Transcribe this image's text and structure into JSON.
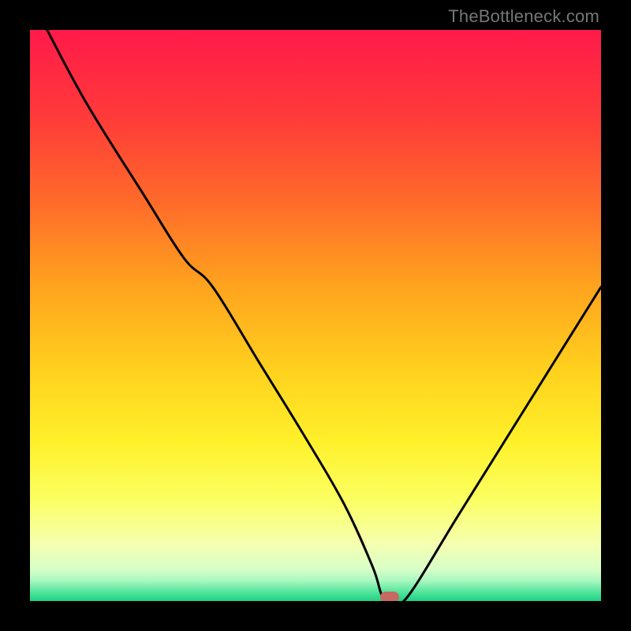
{
  "watermark": "TheBottleneck.com",
  "colors": {
    "frame": "#000000",
    "curve": "#000000",
    "marker": "#c66a64",
    "gradient_stops": [
      {
        "offset": 0.0,
        "color": "#ff1a4a"
      },
      {
        "offset": 0.15,
        "color": "#ff3a3a"
      },
      {
        "offset": 0.3,
        "color": "#ff6a2a"
      },
      {
        "offset": 0.45,
        "color": "#ffa41e"
      },
      {
        "offset": 0.6,
        "color": "#ffd21e"
      },
      {
        "offset": 0.72,
        "color": "#fff02a"
      },
      {
        "offset": 0.82,
        "color": "#fbff60"
      },
      {
        "offset": 0.9,
        "color": "#f5ffb0"
      },
      {
        "offset": 0.945,
        "color": "#d8ffc8"
      },
      {
        "offset": 0.965,
        "color": "#a8f7c0"
      },
      {
        "offset": 0.985,
        "color": "#4fe49a"
      },
      {
        "offset": 1.0,
        "color": "#1fd184"
      }
    ]
  },
  "chart_data": {
    "type": "line",
    "title": "",
    "xlabel": "",
    "ylabel": "",
    "xlim": [
      0,
      100
    ],
    "ylim": [
      0,
      100
    ],
    "series": [
      {
        "name": "bottleneck-curve",
        "x": [
          3,
          10,
          20,
          27,
          32,
          40,
          48,
          55,
          60,
          61.75,
          63.5,
          66,
          75,
          85,
          95,
          100
        ],
        "y": [
          100,
          87,
          71,
          60,
          55,
          42,
          29,
          17,
          6,
          0.75,
          0.75,
          0.6,
          15,
          31,
          47,
          55
        ]
      }
    ],
    "marker": {
      "x": 63,
      "y": 0.75
    }
  }
}
